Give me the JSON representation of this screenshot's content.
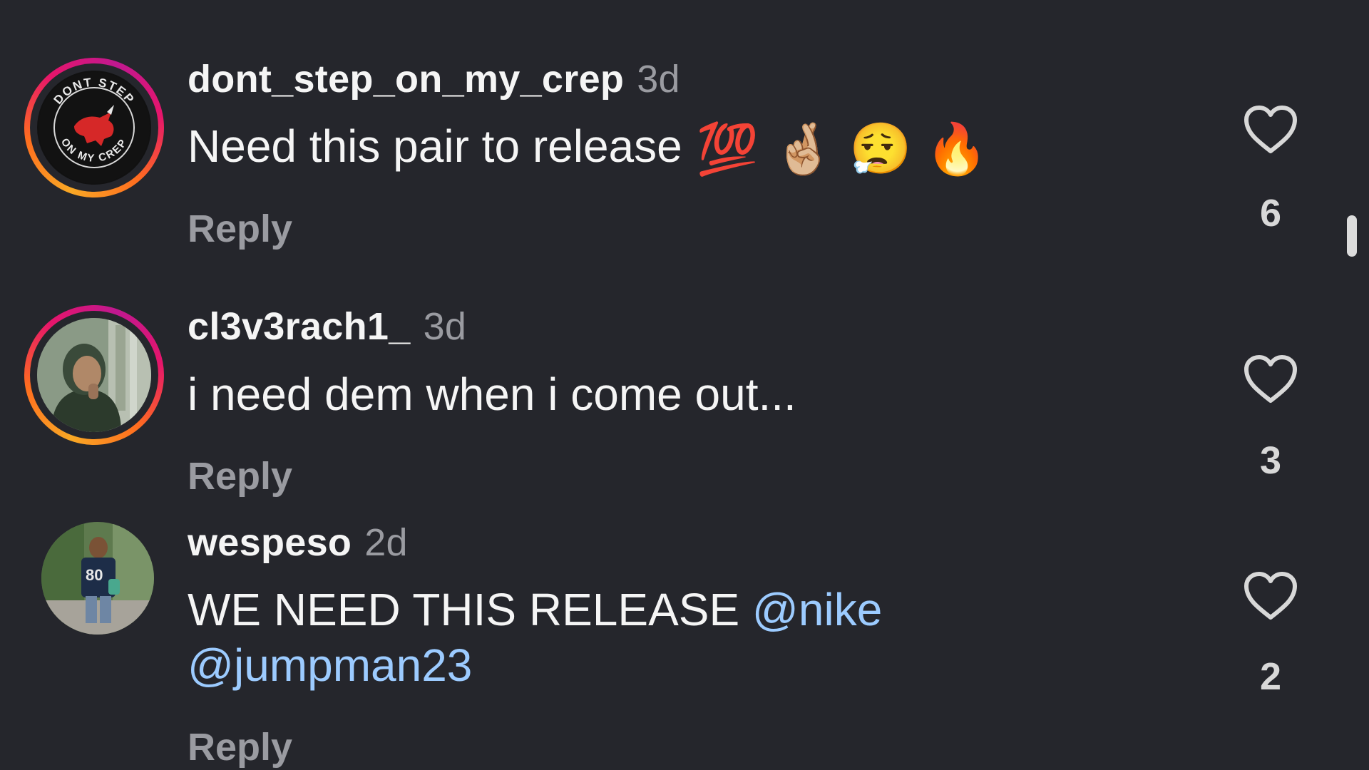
{
  "comments": [
    {
      "username": "dont_step_on_my_crep",
      "time": "3d",
      "text": "Need this pair to release",
      "emojis": [
        "💯",
        "🤞🏼",
        "😮‍💨",
        "🔥"
      ],
      "reply_label": "Reply",
      "likes": "6",
      "avatar_text_top": "DONT STEP",
      "avatar_text_bottom": "ON MY CREP"
    },
    {
      "username": "cl3v3rach1_",
      "time": "3d",
      "text": "i need dem when i come out...",
      "reply_label": "Reply",
      "likes": "3"
    },
    {
      "username": "wespeso",
      "time": "2d",
      "text": "WE NEED THIS RELEASE",
      "mention1": "@nike",
      "mention2": "@jumpman23",
      "reply_label": "Reply",
      "likes": "2",
      "jersey_number": "80"
    }
  ],
  "icons": {
    "like": "heart-outline-icon"
  },
  "colors": {
    "background": "#25262c",
    "text": "#f5f5f5",
    "muted": "#9a9ba1",
    "mention": "#9ccbff"
  }
}
